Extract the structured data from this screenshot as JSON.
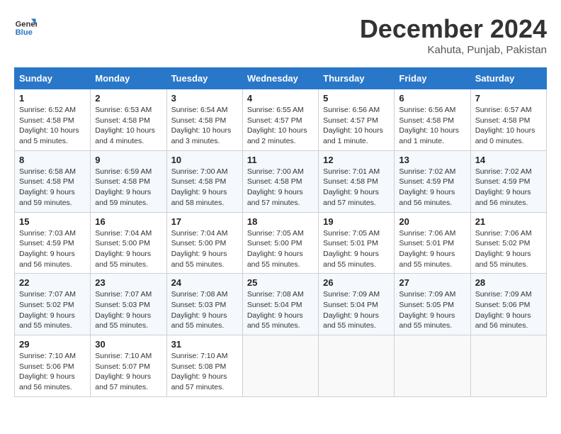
{
  "header": {
    "logo_line1": "General",
    "logo_line2": "Blue",
    "month": "December 2024",
    "location": "Kahuta, Punjab, Pakistan"
  },
  "weekdays": [
    "Sunday",
    "Monday",
    "Tuesday",
    "Wednesday",
    "Thursday",
    "Friday",
    "Saturday"
  ],
  "weeks": [
    [
      {
        "day": "1",
        "sunrise": "6:52 AM",
        "sunset": "4:58 PM",
        "daylight": "10 hours and 5 minutes."
      },
      {
        "day": "2",
        "sunrise": "6:53 AM",
        "sunset": "4:58 PM",
        "daylight": "10 hours and 4 minutes."
      },
      {
        "day": "3",
        "sunrise": "6:54 AM",
        "sunset": "4:58 PM",
        "daylight": "10 hours and 3 minutes."
      },
      {
        "day": "4",
        "sunrise": "6:55 AM",
        "sunset": "4:57 PM",
        "daylight": "10 hours and 2 minutes."
      },
      {
        "day": "5",
        "sunrise": "6:56 AM",
        "sunset": "4:57 PM",
        "daylight": "10 hours and 1 minute."
      },
      {
        "day": "6",
        "sunrise": "6:56 AM",
        "sunset": "4:58 PM",
        "daylight": "10 hours and 1 minute."
      },
      {
        "day": "7",
        "sunrise": "6:57 AM",
        "sunset": "4:58 PM",
        "daylight": "10 hours and 0 minutes."
      }
    ],
    [
      {
        "day": "8",
        "sunrise": "6:58 AM",
        "sunset": "4:58 PM",
        "daylight": "9 hours and 59 minutes."
      },
      {
        "day": "9",
        "sunrise": "6:59 AM",
        "sunset": "4:58 PM",
        "daylight": "9 hours and 59 minutes."
      },
      {
        "day": "10",
        "sunrise": "7:00 AM",
        "sunset": "4:58 PM",
        "daylight": "9 hours and 58 minutes."
      },
      {
        "day": "11",
        "sunrise": "7:00 AM",
        "sunset": "4:58 PM",
        "daylight": "9 hours and 57 minutes."
      },
      {
        "day": "12",
        "sunrise": "7:01 AM",
        "sunset": "4:58 PM",
        "daylight": "9 hours and 57 minutes."
      },
      {
        "day": "13",
        "sunrise": "7:02 AM",
        "sunset": "4:59 PM",
        "daylight": "9 hours and 56 minutes."
      },
      {
        "day": "14",
        "sunrise": "7:02 AM",
        "sunset": "4:59 PM",
        "daylight": "9 hours and 56 minutes."
      }
    ],
    [
      {
        "day": "15",
        "sunrise": "7:03 AM",
        "sunset": "4:59 PM",
        "daylight": "9 hours and 56 minutes."
      },
      {
        "day": "16",
        "sunrise": "7:04 AM",
        "sunset": "5:00 PM",
        "daylight": "9 hours and 55 minutes."
      },
      {
        "day": "17",
        "sunrise": "7:04 AM",
        "sunset": "5:00 PM",
        "daylight": "9 hours and 55 minutes."
      },
      {
        "day": "18",
        "sunrise": "7:05 AM",
        "sunset": "5:00 PM",
        "daylight": "9 hours and 55 minutes."
      },
      {
        "day": "19",
        "sunrise": "7:05 AM",
        "sunset": "5:01 PM",
        "daylight": "9 hours and 55 minutes."
      },
      {
        "day": "20",
        "sunrise": "7:06 AM",
        "sunset": "5:01 PM",
        "daylight": "9 hours and 55 minutes."
      },
      {
        "day": "21",
        "sunrise": "7:06 AM",
        "sunset": "5:02 PM",
        "daylight": "9 hours and 55 minutes."
      }
    ],
    [
      {
        "day": "22",
        "sunrise": "7:07 AM",
        "sunset": "5:02 PM",
        "daylight": "9 hours and 55 minutes."
      },
      {
        "day": "23",
        "sunrise": "7:07 AM",
        "sunset": "5:03 PM",
        "daylight": "9 hours and 55 minutes."
      },
      {
        "day": "24",
        "sunrise": "7:08 AM",
        "sunset": "5:03 PM",
        "daylight": "9 hours and 55 minutes."
      },
      {
        "day": "25",
        "sunrise": "7:08 AM",
        "sunset": "5:04 PM",
        "daylight": "9 hours and 55 minutes."
      },
      {
        "day": "26",
        "sunrise": "7:09 AM",
        "sunset": "5:04 PM",
        "daylight": "9 hours and 55 minutes."
      },
      {
        "day": "27",
        "sunrise": "7:09 AM",
        "sunset": "5:05 PM",
        "daylight": "9 hours and 55 minutes."
      },
      {
        "day": "28",
        "sunrise": "7:09 AM",
        "sunset": "5:06 PM",
        "daylight": "9 hours and 56 minutes."
      }
    ],
    [
      {
        "day": "29",
        "sunrise": "7:10 AM",
        "sunset": "5:06 PM",
        "daylight": "9 hours and 56 minutes."
      },
      {
        "day": "30",
        "sunrise": "7:10 AM",
        "sunset": "5:07 PM",
        "daylight": "9 hours and 57 minutes."
      },
      {
        "day": "31",
        "sunrise": "7:10 AM",
        "sunset": "5:08 PM",
        "daylight": "9 hours and 57 minutes."
      },
      null,
      null,
      null,
      null
    ]
  ]
}
